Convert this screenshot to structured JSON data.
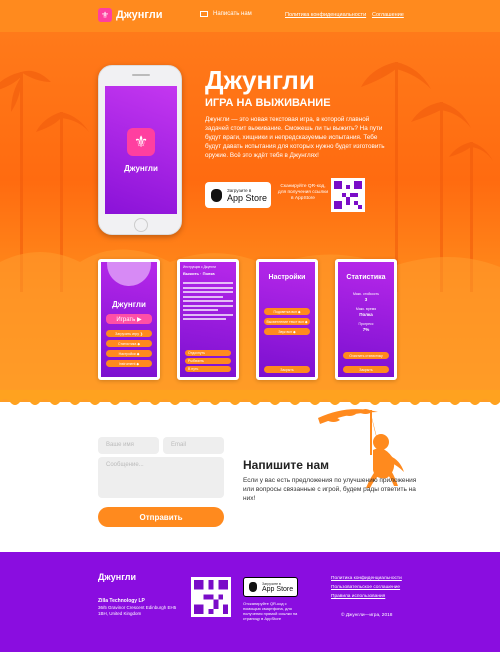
{
  "nav": {
    "logo_text": "Джунгли",
    "write_us": "Написать нам",
    "privacy": "Политика конфиденциальности",
    "agreement": "Соглашение"
  },
  "hero": {
    "title": "Джунгли",
    "subtitle": "ИГРА НА ВЫЖИВАНИЕ",
    "description": "Джунгли — это новая текстовая игра, в которой главной задачей стоит выживание. Сможешь ли ты выжить? На пути будут враги, хищники и непредсказуемые испытания. Тебе будут давать испытания для которых нужно будет изготовить оружие. Всё это ждёт тебя в Джунглях!",
    "appstore_small": "Загрузите в",
    "appstore_big": "App Store",
    "qr_text": "Сканируйте QR-код, для получения ссылки в AppStore",
    "phone_app_name": "Джунгли"
  },
  "screens": [
    {
      "title": "Джунгли",
      "play": "Играть ▶",
      "buttons": [
        "Загрузить игру ❯",
        "Статистика ◆",
        "Настройки ◆",
        "Instrument ◆"
      ]
    },
    {
      "header": "Инструкция с Джунгли",
      "sub": "Выжить · Полка",
      "lines": [
        "Отдохнуть",
        "Рыбачить",
        "В путь"
      ]
    },
    {
      "title": "Настройки",
      "buttons": [
        "Подсветка вкл ◆",
        "Высветление текст вкл ◆",
        "Звук вкл ◆"
      ],
      "close": "Закрыть"
    },
    {
      "title": "Статистика",
      "lines": [
        "Макс. стойкость",
        "3",
        "Макс. время",
        "Полка",
        "Прогресс",
        "7%"
      ],
      "buttons": [
        "Очистить статистику",
        "Закрыть"
      ]
    }
  ],
  "contact": {
    "name_placeholder": "Ваше имя",
    "email_placeholder": "Email",
    "message_placeholder": "Сообщение...",
    "send": "Отправить",
    "title": "Напишите нам",
    "description": "Если у вас есть предложения по улучшению приложения или вопросы связанные с игрой, будем рады ответить на них!"
  },
  "footer": {
    "title": "Джунгли",
    "company": "Zilla Technology LP",
    "address": "36/5 Gravinor Crescent Edinburgh EH5 1BH, United Kingdom",
    "appstore_small": "Загрузите в",
    "appstore_big": "App Store",
    "qr_text": "Отсканируйте QR-код с помощью смартфона, для получения прямой ссылки на страницу в AppStore",
    "links": [
      "Политика конфиденциальности",
      "Пользовательское соглашение",
      "Правила использования"
    ],
    "copyright": "© Джунгли—игра, 2018"
  },
  "colors": {
    "orange": "#ff8a1e",
    "purple": "#8a0de0",
    "pink": "#ff3fa0"
  }
}
